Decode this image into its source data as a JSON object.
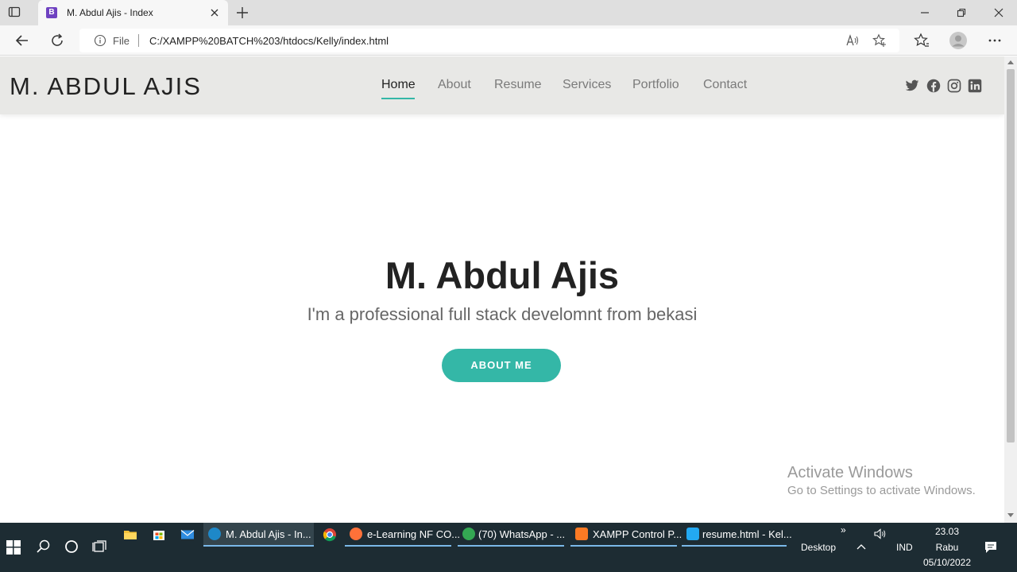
{
  "browser": {
    "tab_title": "M. Abdul Ajis - Index",
    "tab_favicon_letter": "B",
    "address_scheme_label": "File",
    "url": "C:/XAMPP%20BATCH%203/htdocs/Kelly/index.html"
  },
  "site": {
    "logo": "M. ABDUL AJIS",
    "nav": [
      "Home",
      "About",
      "Resume",
      "Services",
      "Portfolio",
      "Contact"
    ],
    "active_nav": "Home",
    "social_icons": [
      "twitter-icon",
      "facebook-icon",
      "instagram-icon",
      "linkedin-icon"
    ],
    "hero_title": "M. Abdul Ajis",
    "hero_subtitle": "I'm a professional full stack develomnt from bekasi",
    "cta_label": "ABOUT ME",
    "accent_color": "#34b7a7"
  },
  "watermark": {
    "line1": "Activate Windows",
    "line2": "Go to Settings to activate Windows."
  },
  "taskbar": {
    "tasks": [
      "M. Abdul Ajis - In...",
      "e-Learning NF CO...",
      "(70) WhatsApp - ...",
      "XAMPP Control P...",
      "resume.html - Kel..."
    ],
    "desktop_label": "Desktop",
    "lang": "IND",
    "time": "23.03",
    "day": "Rabu",
    "date": "05/10/2022"
  }
}
